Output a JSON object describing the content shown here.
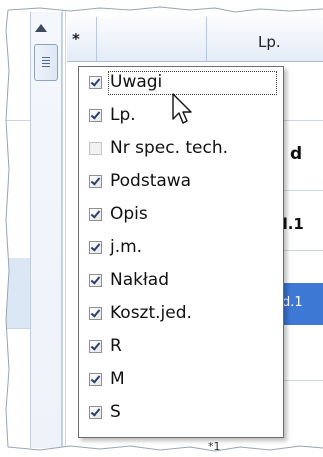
{
  "grid": {
    "header_star": "*",
    "header_lp": "Lp.",
    "cell_d": "d",
    "cell_d1": "d.1",
    "cell_d1_selected": "d.1",
    "bottom_mark": "*1"
  },
  "popup": {
    "items": [
      {
        "label": "Uwagi",
        "checked": true
      },
      {
        "label": "Lp.",
        "checked": true
      },
      {
        "label": "Nr spec. tech.",
        "checked": false
      },
      {
        "label": "Podstawa",
        "checked": true
      },
      {
        "label": "Opis",
        "checked": true
      },
      {
        "label": "j.m.",
        "checked": true
      },
      {
        "label": "Nakład",
        "checked": true
      },
      {
        "label": "Koszt.jed.",
        "checked": true
      },
      {
        "label": "R",
        "checked": true
      },
      {
        "label": "M",
        "checked": true
      },
      {
        "label": "S",
        "checked": true
      }
    ]
  },
  "colors": {
    "selection_blue": "#3d78d4",
    "checkmark": "#2b3f6c",
    "left_highlight": "#dce7f6"
  },
  "icons": {
    "scroll_up": "triangle-up",
    "cursor": "arrow-pointer"
  }
}
